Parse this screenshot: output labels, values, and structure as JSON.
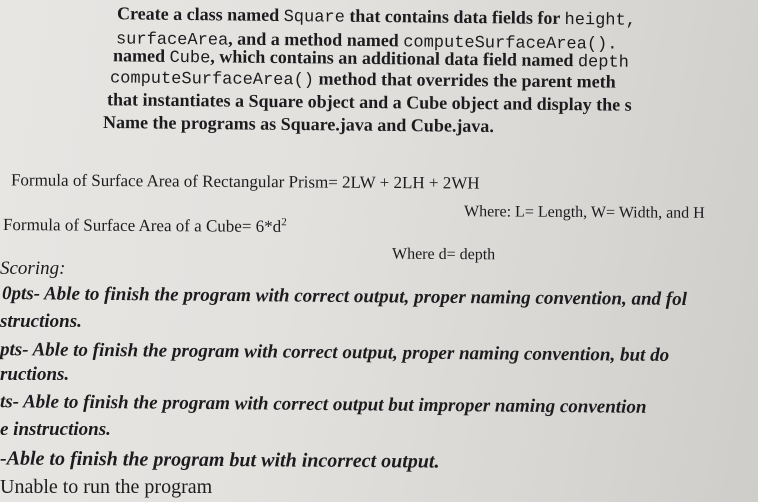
{
  "task": {
    "l1_a": "Create a class named ",
    "l1_code": "Square",
    "l1_b": " that contains data fields for ",
    "l1_code2": "height,",
    "l2_code": "surfaceArea",
    "l2_a": ", and a method named ",
    "l2_code2": "computeSurfaceArea().",
    "l3_a": "named ",
    "l3_code": "Cube",
    "l3_b": ", which contains an additional data field named ",
    "l3_code2": "depth",
    "l4_code": "computeSurfaceArea()",
    "l4_a": " method that overrides the parent meth",
    "l5": "that instantiates a Square object and a Cube object and display the s",
    "l6_a": "Name the programs as ",
    "l6_b": "Square.java",
    "l6_c": " and ",
    "l6_d": "Cube.java",
    "l6_e": "."
  },
  "formulas": {
    "prism_label": "Formula of Surface Area of Rectangular Prism= ",
    "prism_expr": "2LW + 2LH + 2WH",
    "prism_where": "Where: L= Length, W= Width, and H",
    "cube_label": "Formula of Surface Area of a Cube= 6*d",
    "cube_exp": "2",
    "cube_where": "Where d= depth"
  },
  "scoring": {
    "heading": "Scoring:",
    "items": [
      "0pts- Able to finish the program with correct output, proper naming convention, and fol",
      "structions.",
      "pts- Able to finish the program with correct output, proper naming convention, but do",
      "ructions.",
      "ts- Able to finish the program with correct output but improper naming convention",
      "e instructions.",
      "-Able to finish the program but with incorrect output.",
      "Unable to run the program"
    ]
  }
}
